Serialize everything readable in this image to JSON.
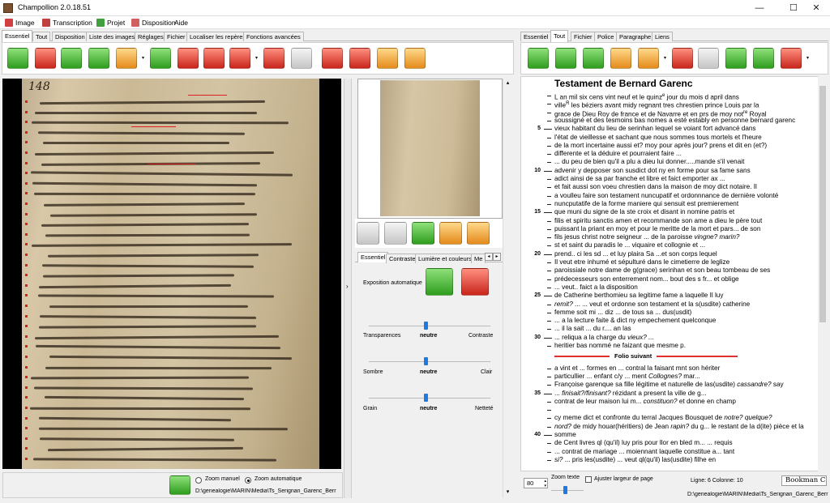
{
  "window": {
    "title": "Champollion  2.0.18.51",
    "controls": {
      "minimize": "—",
      "maximize": "☐",
      "close": "✕"
    }
  },
  "menu": [
    {
      "label": "Image",
      "icon": "image-menu-icon",
      "color": "#d04040"
    },
    {
      "label": "Transcription",
      "icon": "transcription-menu-icon",
      "color": "#c04040"
    },
    {
      "label": "Projet",
      "icon": "project-menu-icon",
      "color": "#40a040"
    },
    {
      "label": "Disposition",
      "icon": "layout-menu-icon",
      "color": "#d06060"
    },
    {
      "label": "Aide",
      "icon": "",
      "color": ""
    }
  ],
  "left_tabs": [
    "Essentiel",
    "Tout",
    "Disposition",
    "Liste des images",
    "Réglages",
    "Fichier",
    "Localiser les repères",
    "Fonctions avancées"
  ],
  "right_tabs": [
    "Essentiel",
    "Tout",
    "Fichier",
    "Police",
    "Paragraphe",
    "Liens"
  ],
  "mid_tabs": [
    "Essentiel",
    "Contraste",
    "Lumière et couleurs",
    "Me"
  ],
  "exposition": {
    "label": "Exposition automatique"
  },
  "sliders": [
    {
      "left": "Transparences",
      "center": "neutre",
      "right": "Contraste",
      "level": 0.5
    },
    {
      "left": "Sombre",
      "center": "neutre",
      "right": "Clair",
      "level": 0.5
    },
    {
      "left": "Grain",
      "center": "neutre",
      "right": "Netteté",
      "level": 0.5
    }
  ],
  "zoom": {
    "manual": "Zoom manuel",
    "auto": "Zoom automatique",
    "selected": "auto"
  },
  "left_path": "D:\\genealogie\\MARIN\\Media\\Ts_Serignan_Garenc_Berr",
  "document": {
    "folio_number": "148"
  },
  "transcription": {
    "title": "Testament de Bernard Garenc",
    "folio_suivant": "Folio suivant",
    "line_numbers": [
      "5",
      "10",
      "15",
      "20",
      "25",
      "30",
      "35",
      "40"
    ],
    "lines": [
      [
        {
          "t": "L an mil six cens vint neuf et le quinz"
        },
        {
          "t": "e",
          "sup": true
        },
        {
          "t": " jour du mois d april dans"
        }
      ],
      [
        {
          "t": "ville"
        },
        {
          "t": "R",
          "sup": true
        },
        {
          "t": "  les béziers avant midy regnant tres chrestien prince Louis par la"
        }
      ],
      [
        {
          "t": "grace de Dieu Roy de france et de Navarre et en prs de moy not"
        },
        {
          "t": "re",
          "sup": true
        },
        {
          "t": " Royal"
        }
      ],
      [
        {
          "t": "soussigné et des tesmoins bas nomes a esté estably en personne bernard garenc"
        }
      ],
      [
        {
          "t": "vieux habitant du lieu de serinhan  lequel se voiant fort advancé dans"
        }
      ],
      [
        {
          "t": "l'état de vieillesse et sachant que nous sommes tous mortels et l'heure"
        }
      ],
      [
        {
          "t": "de la mort incertaine aussi  et? moy pour après jour? prens et dit en (et?)"
        }
      ],
      [
        {
          "t": "differente et la déduire et pourraient faire ..."
        }
      ],
      [
        {
          "t": "... du peu de bien qu'il a plu a dieu  lui donner.....mande s'il venait"
        }
      ],
      [
        {
          "t": "advenir  y depposer son susdict dot ny en forme pour sa fame sans"
        }
      ],
      [
        {
          "t": "adict ainsi de sa par franche et libre et faict emporter ax ..."
        }
      ],
      [
        {
          "t": "et fait aussi son voeu chrestien dans la maison de moy dict notaire. Il"
        }
      ],
      [
        {
          "t": "a voulleu faire son testament nuncupatif  et ordonnnance de dernière volonté"
        }
      ],
      [
        {
          "t": "nuncputatife de la forme maniere qui sensuit est premierement"
        }
      ],
      [
        {
          "t": "que muni du signe de la ste croix et disant in nomine patris et"
        }
      ],
      [
        {
          "t": "filis et spiritu sanctis  amen et recommande son ame a dieu le père tout"
        }
      ],
      [
        {
          "t": "puissant la priant en moy et pour le meritte de la mort et pars... de son"
        }
      ],
      [
        {
          "t": "fils jesus christ notre seigneur ...  de la paroisse "
        },
        {
          "t": "vingne? marin?",
          "i": true
        }
      ],
      [
        {
          "t": "st et saint du paradis le ... viquaire et collognie et ..."
        }
      ],
      [
        {
          "t": "prend.. ci les sd ...  et luy plaira Sa ...et son corps lequel"
        }
      ],
      [
        {
          "t": "Il veut etre inhumé et sépulturé dans le cimetierre de leglize"
        }
      ],
      [
        {
          "t": "paroissiale notre dame de g(grace) serinhan et son beau tombeau de ses"
        }
      ],
      [
        {
          "t": "prédecesseurs son enterrement nom... bout des s fr... et oblige"
        }
      ],
      [
        {
          "t": "... veut.. faict a la disposition"
        }
      ],
      [
        {
          "t": "de Catherine berthomieu sa  legitime fame a laquelle Il luy"
        }
      ],
      [
        {
          "t": "remit?",
          "i": true
        },
        {
          "t": " ... ... veut et ordonne son testament et la s(usdite) catherine"
        }
      ],
      [
        {
          "t": "femme soit mi ...  diz ... de tous sa ... dus(usdit)"
        }
      ],
      [
        {
          "t": "... a la lecture faite & dict ny empechement quelconque"
        }
      ],
      [
        {
          "t": "... il la sait ... du r.... an las"
        }
      ],
      [
        {
          "t": "... reliqua a la charge du "
        },
        {
          "t": "vieux? ...",
          "i": true
        }
      ],
      [
        {
          "t": "heritier bas nommé ne faizant  que mesme p."
        }
      ],
      [
        {
          "t": "__FOLIO__"
        }
      ],
      [
        {
          "t": "a vint et ... formes en ... contral la faisant mnt son hériter"
        }
      ],
      [
        {
          "t": "particullier ... enfant c/y ... ment "
        },
        {
          "t": "Collognes?",
          "i": true
        },
        {
          "t": " mar..."
        }
      ],
      [
        {
          "t": "Françoise garenque sa fille légitime et naturelle de las(usdite) "
        },
        {
          "t": "cassandre?",
          "i": true
        },
        {
          "t": " say"
        }
      ],
      [
        {
          "t": "... "
        },
        {
          "t": "finisait?/finisant?",
          "i": true
        },
        {
          "t": " rézidant a present la ville de g..."
        }
      ],
      [
        {
          "t": "contrat de leur maison lui m... "
        },
        {
          "t": "constituon?",
          "i": true
        },
        {
          "t": " et donne en champ"
        }
      ],
      [
        {
          "t": ""
        }
      ],
      [
        {
          "t": "cy meme dict et confronte du terral Jacques Bousquet de "
        },
        {
          "t": "notre? quelque?",
          "i": true
        }
      ],
      [
        {
          "t": "nord?",
          "i": true
        },
        {
          "t": " de midy houar(héritiers) de Jean "
        },
        {
          "t": "rapin?",
          "i": true
        },
        {
          "t": " du g... le restant de la d(ite) pièce et la"
        }
      ],
      [
        {
          "t": "somme"
        }
      ],
      [
        {
          "t": "de Cent livres ql (qu'il) luy pris pour llor en bled m... ... requis"
        }
      ],
      [
        {
          "t": "... contrat de mariage ... moiennant laquelle constitue a... tant"
        }
      ],
      [
        {
          "t": "si?",
          "i": true
        },
        {
          "t": " ...  pris les(usdite) ... veut ql(qu'il) las(usdite) filhe en"
        }
      ]
    ]
  },
  "bottom_right": {
    "zoom_value": "80",
    "zoom_texte": "Zoom texte",
    "ajuster": "Ajuster largeur de page",
    "position": "Ligne: 6 Colonne: 10",
    "font": "Bookman C",
    "path": "D:\\genealogie\\MARIN\\Media\\Ts_Serignan_Garenc_Berr"
  },
  "colors": {
    "accent": "#1e7ae0",
    "folio_rule": "#e03030",
    "toolbar_green": "#2e9d1e"
  }
}
